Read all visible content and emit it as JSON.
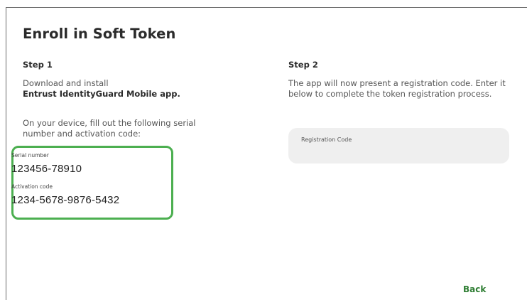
{
  "dialog": {
    "title": "Enroll in Soft Token"
  },
  "step1": {
    "heading": "Step 1",
    "download_text": "Download and install",
    "app_name": "Entrust IdentityGuard Mobile app.",
    "instructions": "On your device, fill out the following serial number and activation code:",
    "serial_label": "Serial number",
    "serial_value": "123456-78910",
    "activation_label": "Activation code",
    "activation_value": "1234-5678-9876-5432"
  },
  "step2": {
    "heading": "Step 2",
    "instructions": "The app will now present a registration code. Enter it below to complete the token registration process.",
    "registration_field": {
      "label": "Registration Code",
      "value": ""
    }
  },
  "actions": {
    "back_label": "Back"
  },
  "colors": {
    "highlight_border": "#4caf50",
    "back_button": "#2e7d32",
    "field_background": "#efefef"
  }
}
